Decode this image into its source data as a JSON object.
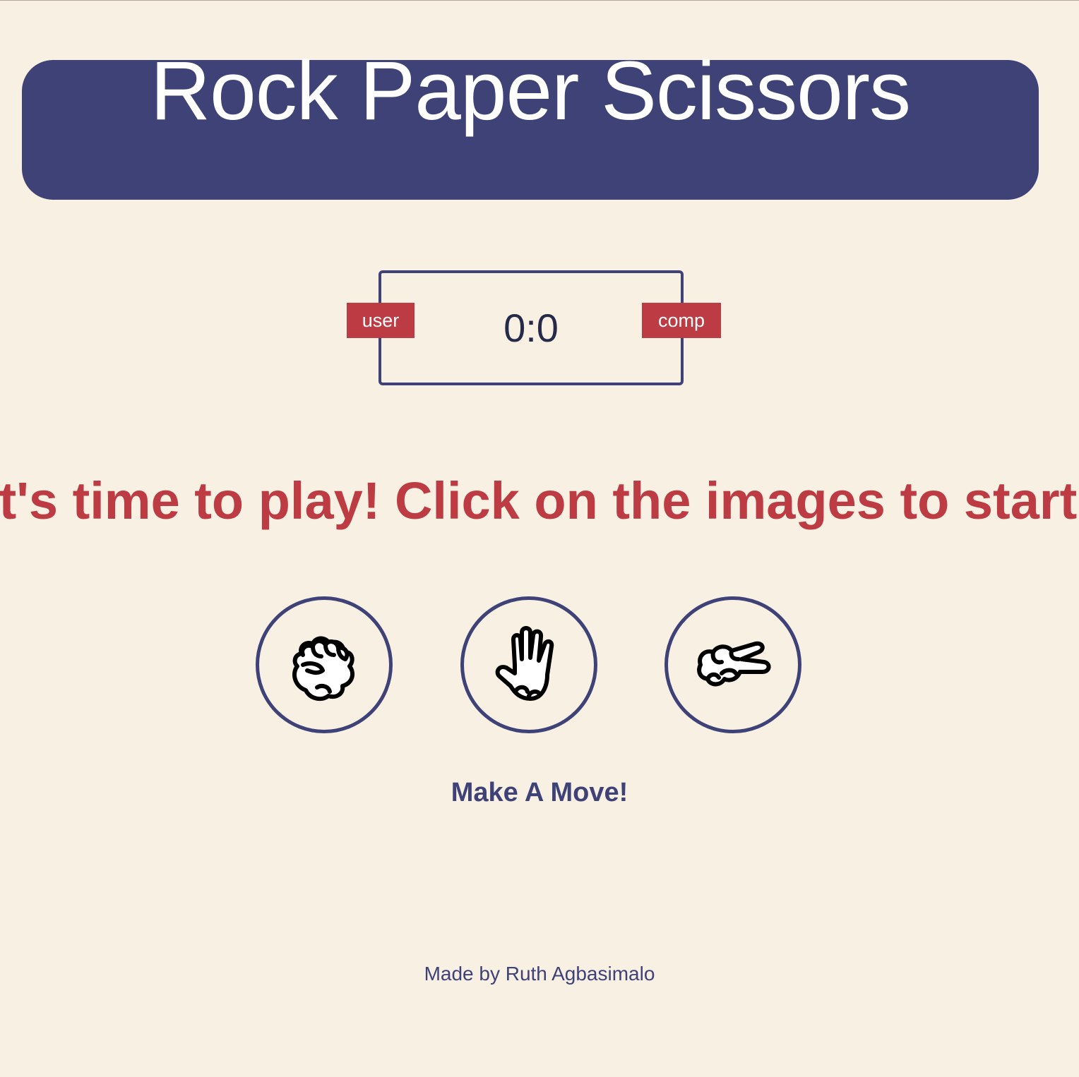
{
  "header": {
    "title": "Rock Paper Scissors"
  },
  "scoreboard": {
    "score": "0:0",
    "user_label": "user",
    "comp_label": "comp"
  },
  "message": "It's time to play! Click on the images to start!",
  "choices": [
    {
      "id": "rock",
      "icon": "rock-hand-icon"
    },
    {
      "id": "paper",
      "icon": "paper-hand-icon"
    },
    {
      "id": "scissors",
      "icon": "scissors-hand-icon"
    }
  ],
  "prompt": "Make A Move!",
  "footer": {
    "credit": "Made by Ruth Agbasimalo"
  },
  "colors": {
    "background": "#f9f0e4",
    "primary": "#3e4277",
    "accent": "#bd3b43"
  }
}
